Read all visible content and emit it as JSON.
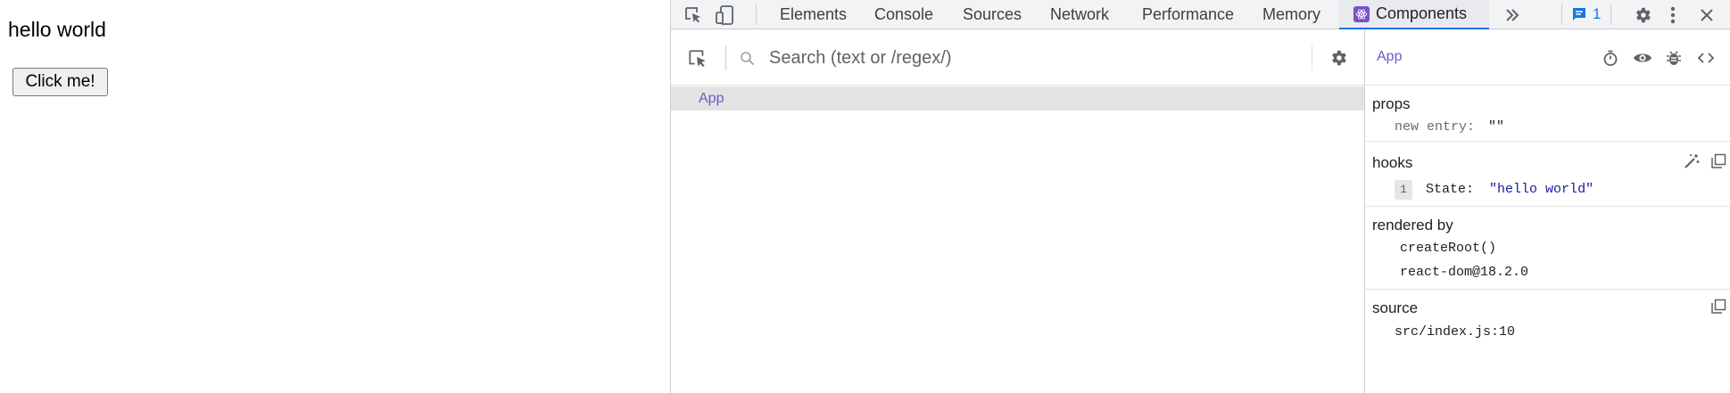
{
  "page": {
    "heading": "hello world",
    "button_label": "Click me!"
  },
  "devtools": {
    "tabs": [
      {
        "label": "Elements"
      },
      {
        "label": "Console"
      },
      {
        "label": "Sources"
      },
      {
        "label": "Network"
      },
      {
        "label": "Performance"
      },
      {
        "label": "Memory"
      },
      {
        "label": "Components",
        "active": true
      }
    ],
    "issues_count": "1",
    "colors": {
      "accent": "#1a73e8",
      "component_name": "#7256c7",
      "string_value": "#1a1aa6",
      "tab_bar_bg": "#f1f3f4",
      "selected_row_bg": "#e3e3e3"
    },
    "icons": {
      "inspect": "select-element-icon",
      "device": "device-toolbar-icon",
      "react": "react-logo-icon",
      "more_tabs": "chevron-double-right-icon",
      "issues": "message-icon",
      "settings": "gear-icon",
      "menu": "vertical-dots-icon",
      "close": "close-icon",
      "search": "search-icon",
      "timer": "stopwatch-icon",
      "view": "eye-icon",
      "debug": "bug-icon",
      "source": "code-icon",
      "edit": "magic-wand-icon",
      "copy": "copy-icon"
    },
    "tree": {
      "search_placeholder": "Search (text or /regex/)",
      "rows": [
        {
          "label": "App",
          "selected": true
        }
      ]
    },
    "inspector": {
      "title": "App",
      "props": {
        "title": "props",
        "items": [
          {
            "key": "new entry:",
            "value": "\"\""
          }
        ]
      },
      "hooks": {
        "title": "hooks",
        "items": [
          {
            "index": "1",
            "key": "State:",
            "value": "\"hello world\""
          }
        ]
      },
      "rendered_by": {
        "title": "rendered by",
        "items": [
          "createRoot()",
          "react-dom@18.2.0"
        ]
      },
      "source": {
        "title": "source",
        "value": "src/index.js:10"
      }
    }
  }
}
